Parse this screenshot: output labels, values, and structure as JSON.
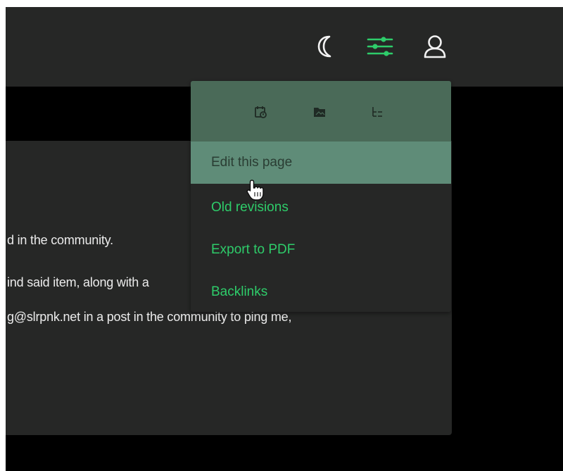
{
  "header": {
    "icons": [
      "moon-icon",
      "settings-sliders-icon",
      "user-icon"
    ]
  },
  "page_tools": {
    "icons": [
      "calendar-icon",
      "media-folder-icon",
      "sitemap-icon"
    ],
    "menu_items": [
      {
        "label": "Edit this page",
        "state": "hovered"
      },
      {
        "label": "Old revisions"
      },
      {
        "label": "Export to PDF"
      },
      {
        "label": "Backlinks"
      }
    ]
  },
  "content": {
    "lines": [
      "d in the community.",
      "ind said item, along with a",
      "g@slrpnk.net in a post in the community to ping me,"
    ]
  },
  "colors": {
    "topbar_bg": "#262726",
    "page_bg": "#000000",
    "accent_green": "#2ecc6a",
    "dropdown_header_bg": "#4a6a58",
    "menu_hover_bg": "#5f8c78"
  }
}
